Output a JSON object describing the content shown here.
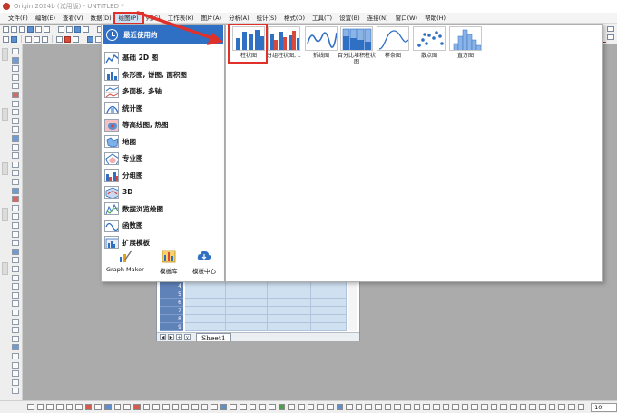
{
  "window": {
    "title": "Origin 2024b (试用版) - UNTITLED *"
  },
  "menubar": {
    "items": [
      "文件(F)",
      "编辑(E)",
      "查看(V)",
      "数据(D)",
      "绘图(P)",
      "列(C)",
      "工作表(K)",
      "图片(A)",
      "分析(A)",
      "统计(S)",
      "格式(O)",
      "工具(T)",
      "设置(B)",
      "连接(N)",
      "窗口(W)",
      "帮助(H)"
    ],
    "active_index": 4
  },
  "graph_menu": {
    "recent_label": "最近使用的",
    "items": [
      {
        "label": "基础 2D 图",
        "icon": "line-chart-icon"
      },
      {
        "label": "条形图, 饼图, 面积图",
        "icon": "bar-pie-chart-icon"
      },
      {
        "label": "多面板, 多轴",
        "icon": "multi-panel-icon"
      },
      {
        "label": "统计图",
        "icon": "statistics-chart-icon"
      },
      {
        "label": "等高线图, 热图",
        "icon": "contour-heatmap-icon"
      },
      {
        "label": "地图",
        "icon": "map-icon"
      },
      {
        "label": "专业图",
        "icon": "specialized-chart-icon"
      },
      {
        "label": "分组图",
        "icon": "grouped-chart-icon"
      },
      {
        "label": "3D",
        "icon": "3d-chart-icon"
      },
      {
        "label": "数据浏览绘图",
        "icon": "data-explore-icon"
      },
      {
        "label": "函数图",
        "icon": "function-plot-icon"
      },
      {
        "label": "扩展模板",
        "icon": "extended-template-icon"
      }
    ],
    "bottom_buttons": [
      {
        "label": "Graph Maker",
        "icon": "graph-maker-icon"
      },
      {
        "label": "模板库",
        "icon": "template-library-icon"
      },
      {
        "label": "模板中心",
        "icon": "template-center-cloud-icon"
      }
    ]
  },
  "recent_graphs": [
    {
      "label": "柱状图",
      "icon": "column-chart-icon"
    },
    {
      "label": "分组柱状图, ..",
      "icon": "grouped-column-chart-icon"
    },
    {
      "label": "折线图",
      "icon": "line-chart-icon"
    },
    {
      "label": "百分比堆积柱状图",
      "icon": "percent-stacked-column-icon"
    },
    {
      "label": "样条图",
      "icon": "spline-chart-icon"
    },
    {
      "label": "散点图",
      "icon": "scatter-chart-icon"
    },
    {
      "label": "直方图",
      "icon": "histogram-icon"
    }
  ],
  "worksheet": {
    "row_numbers": [
      "4",
      "5",
      "6",
      "7",
      "8",
      "9"
    ],
    "header_marker": "…",
    "sheet_tab": "Sheet1",
    "nav_buttons": [
      "◀",
      "▶",
      "+",
      "∨"
    ]
  },
  "bottom_toolbar": {
    "font_size": "10"
  },
  "colors": {
    "accent_blue": "#2f6fc4",
    "highlight_red": "#e0302a",
    "menu_active_bg": "#cfe3f7",
    "workspace_gray": "#ababab"
  }
}
